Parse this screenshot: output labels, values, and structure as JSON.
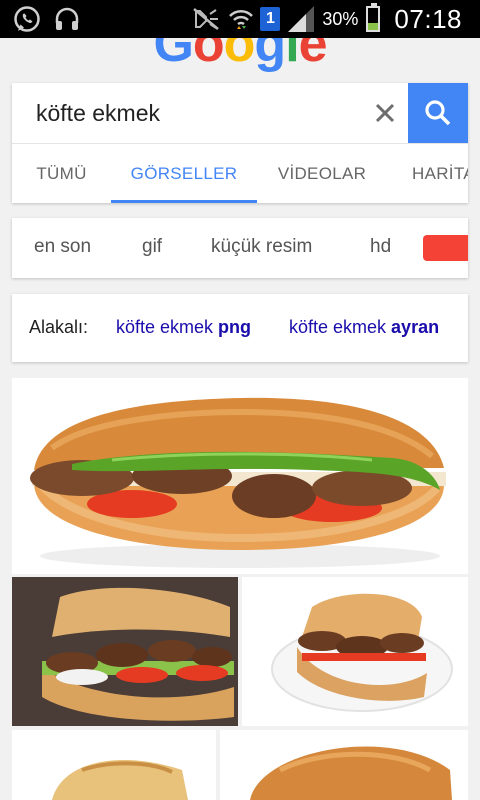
{
  "status_bar": {
    "battery_percent": "30%",
    "battery_level": 0.3,
    "time": "07:18",
    "sim_badge": "1",
    "icons": [
      "whatsapp-icon",
      "headphones-icon",
      "mute-icon",
      "wifi-icon",
      "signal-icon",
      "battery-icon"
    ]
  },
  "logo": {
    "letters": [
      {
        "ch": "G",
        "color": "#4285f4"
      },
      {
        "ch": "o",
        "color": "#ea4335"
      },
      {
        "ch": "o",
        "color": "#fbbc05"
      },
      {
        "ch": "g",
        "color": "#4285f4"
      },
      {
        "ch": "l",
        "color": "#34a853"
      },
      {
        "ch": "e",
        "color": "#ea4335"
      }
    ]
  },
  "search": {
    "query": "köfte ekmek",
    "clear_icon": "close-icon",
    "submit_icon": "search-icon"
  },
  "tabs": [
    {
      "label": "TÜMÜ",
      "active": false
    },
    {
      "label": "GÖRSELLER",
      "active": true
    },
    {
      "label": "VİDEOLAR",
      "active": false
    },
    {
      "label": "HARİTA",
      "active": false
    }
  ],
  "filters": {
    "chips": [
      "en son",
      "gif",
      "küçük resim",
      "hd"
    ],
    "color_chip": "#f44336"
  },
  "related": {
    "label": "Alakalı:",
    "links": [
      {
        "normal": "köfte ekmek ",
        "bold": "png"
      },
      {
        "normal": "köfte ekmek ",
        "bold": "ayran"
      }
    ]
  },
  "colors": {
    "accent": "#4285f4",
    "link": "#1a0dab",
    "background": "#f1f1f1"
  }
}
